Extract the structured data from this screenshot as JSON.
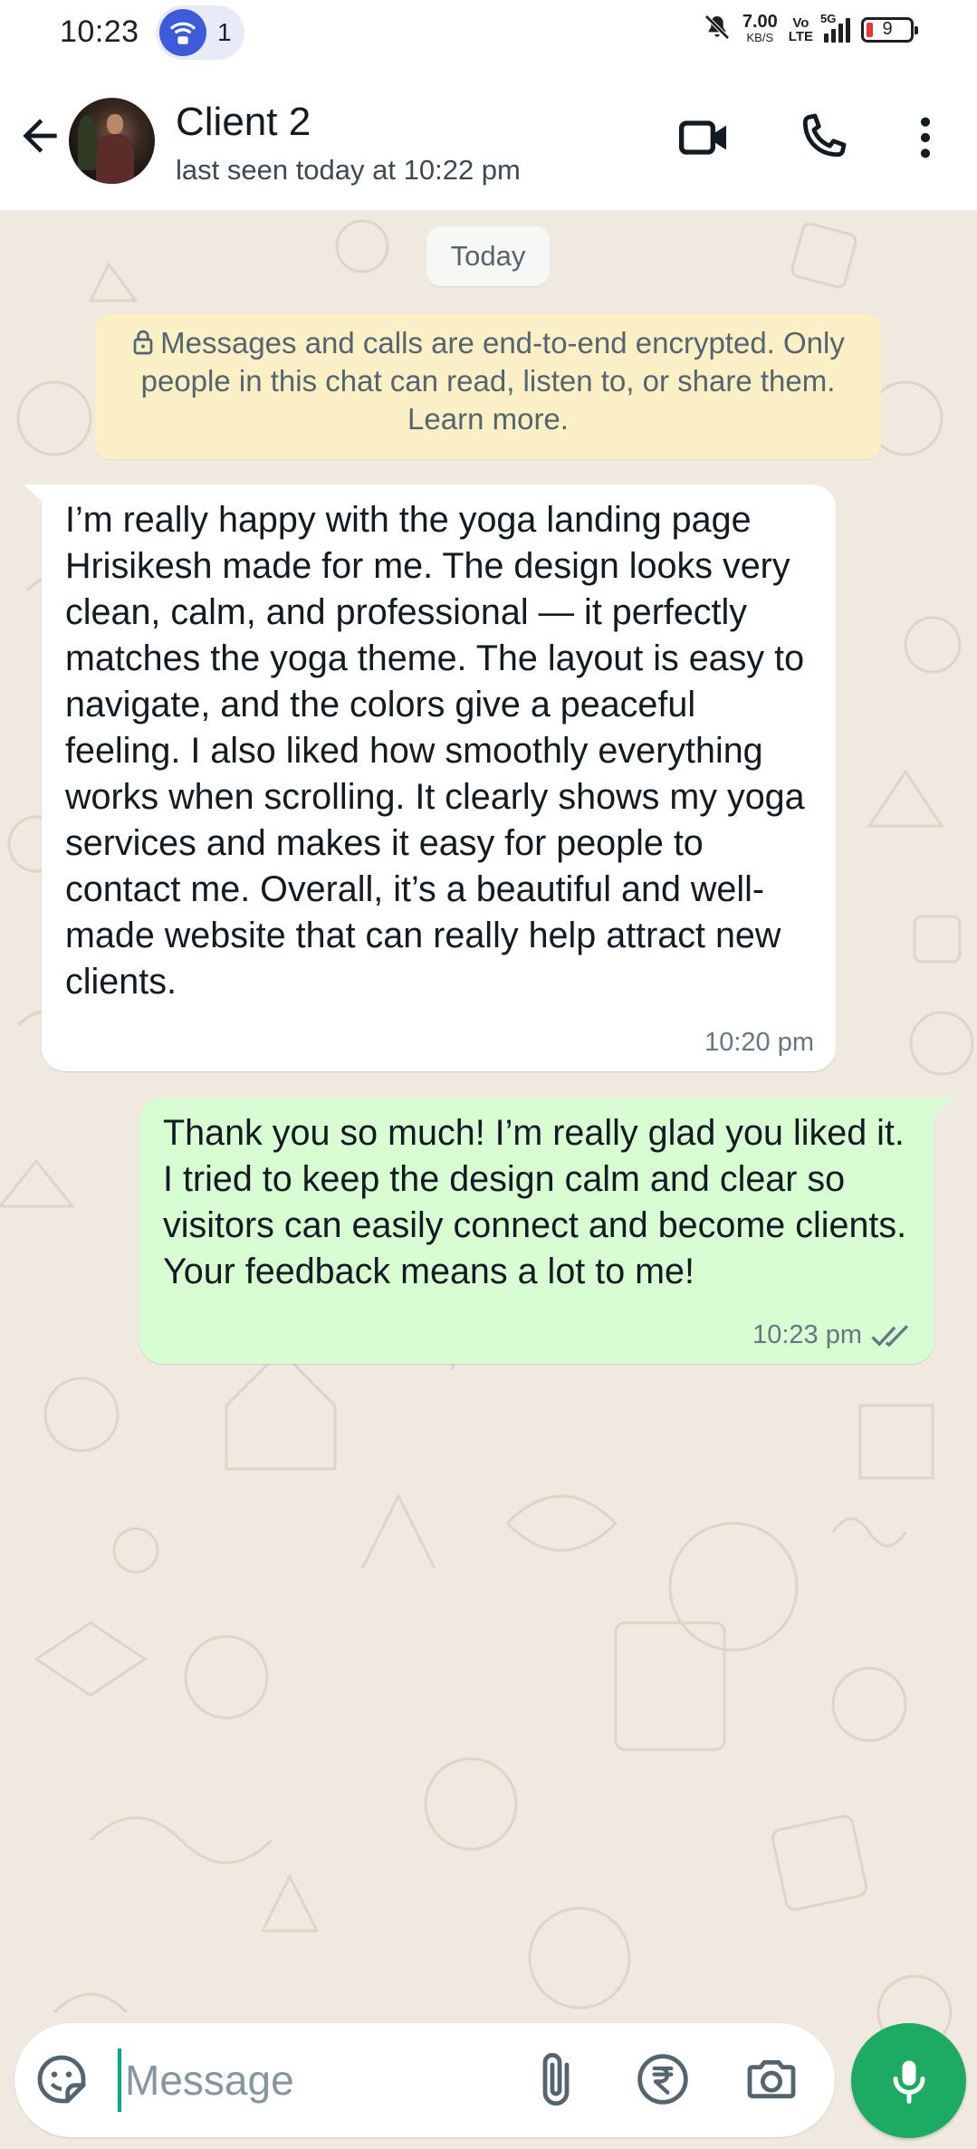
{
  "status_bar": {
    "time": "10:23",
    "hotspot_count": "1",
    "net_speed_value": "7.00",
    "net_speed_unit": "KB/S",
    "volte_top": "Vo",
    "volte_bottom": "LTE",
    "network_type": "5G",
    "battery_level": "9",
    "icons": [
      "hotspot-icon",
      "mute-bell-icon",
      "signal-icon",
      "battery-icon"
    ]
  },
  "header": {
    "contact_name": "Client 2",
    "last_seen": "last seen today at 10:22 pm",
    "icons": [
      "back-arrow-icon",
      "video-call-icon",
      "phone-icon",
      "more-vert-icon"
    ]
  },
  "chat": {
    "date_chip": "Today",
    "encryption_note": "Messages and calls are end-to-end encrypted. Only people in this chat can read, listen to, or share them. Learn more.",
    "messages": [
      {
        "direction": "incoming",
        "text": "I’m really happy with the yoga landing page Hrisikesh made for me. The design looks very clean, calm, and professional — it perfectly matches the yoga theme. The layout is easy to navigate, and the colors give a peaceful feeling. I also liked how smoothly everything works when scrolling. It clearly shows my yoga services and makes it easy for people to contact me. Overall, it’s a beautiful and well-made website that can really help attract new clients.",
        "time": "10:20 pm"
      },
      {
        "direction": "outgoing",
        "text": "Thank you so much! I’m really glad you liked it. I tried to keep the design calm and clear so visitors can easily connect and become clients. Your feedback means a lot to me!",
        "time": "10:23 pm",
        "status": "read"
      }
    ]
  },
  "input": {
    "placeholder": "Message",
    "value": "",
    "icons": [
      "emoji-sticker-icon",
      "attach-icon",
      "rupee-payment-icon",
      "camera-icon",
      "mic-icon"
    ]
  },
  "colors": {
    "chat_background": "#efe9df",
    "incoming_bubble": "#ffffff",
    "outgoing_bubble": "#d9fdd3",
    "encryption_note_bg": "#fbefc5",
    "accent_green": "#1daa61",
    "read_ticks": "#667781"
  }
}
